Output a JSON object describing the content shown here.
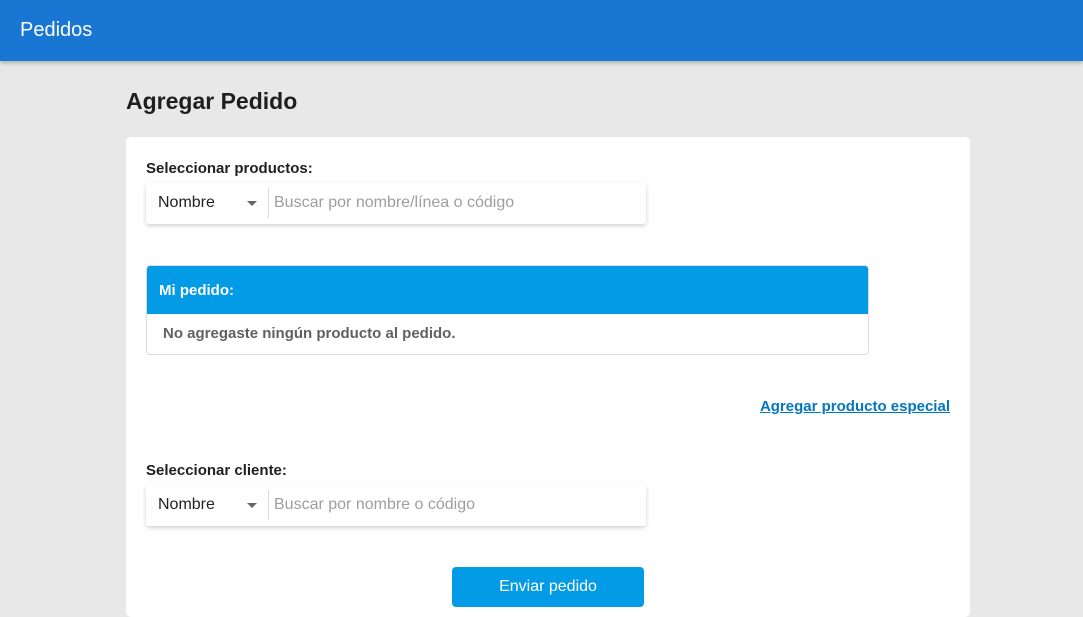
{
  "appbar": {
    "title": "Pedidos"
  },
  "page": {
    "title": "Agregar Pedido"
  },
  "products": {
    "label": "Seleccionar productos:",
    "filter_value": "Nombre",
    "search_placeholder": "Buscar por nombre/línea o código"
  },
  "order": {
    "header": "Mi pedido:",
    "empty_message": "No agregaste ningún producto al pedido."
  },
  "special_product_link": "Agregar producto especial",
  "client": {
    "label": "Seleccionar cliente:",
    "filter_value": "Nombre",
    "search_placeholder": "Buscar por nombre o código"
  },
  "submit_label": "Enviar pedido",
  "colors": {
    "appbar": "#1976d2",
    "accent": "#039be5",
    "link": "#0277bd",
    "background": "#e8e8e8"
  },
  "icons": {
    "select_caret": "caret-down-icon"
  }
}
